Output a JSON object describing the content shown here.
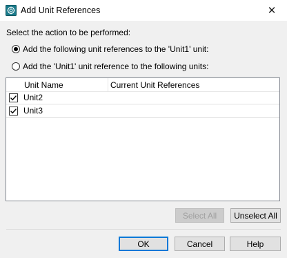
{
  "window": {
    "title": "Add Unit References",
    "close_glyph": "✕",
    "icon": "app-icon"
  },
  "prompt": "Select the action to be performed:",
  "options": [
    {
      "label": "Add the following unit references to the 'Unit1' unit:",
      "selected": true
    },
    {
      "label": "Add the 'Unit1' unit reference to the following units:",
      "selected": false
    }
  ],
  "list": {
    "columns": [
      "Unit Name",
      "Current Unit References"
    ],
    "rows": [
      {
        "name": "Unit2",
        "checked": true,
        "references": ""
      },
      {
        "name": "Unit3",
        "checked": true,
        "references": ""
      }
    ]
  },
  "buttons": {
    "select_all": "Select All",
    "unselect_all": "Unselect All",
    "ok": "OK",
    "cancel": "Cancel",
    "help": "Help"
  },
  "colors": {
    "accent": "#0078d7",
    "icon_teal": "#1a7a8a"
  }
}
